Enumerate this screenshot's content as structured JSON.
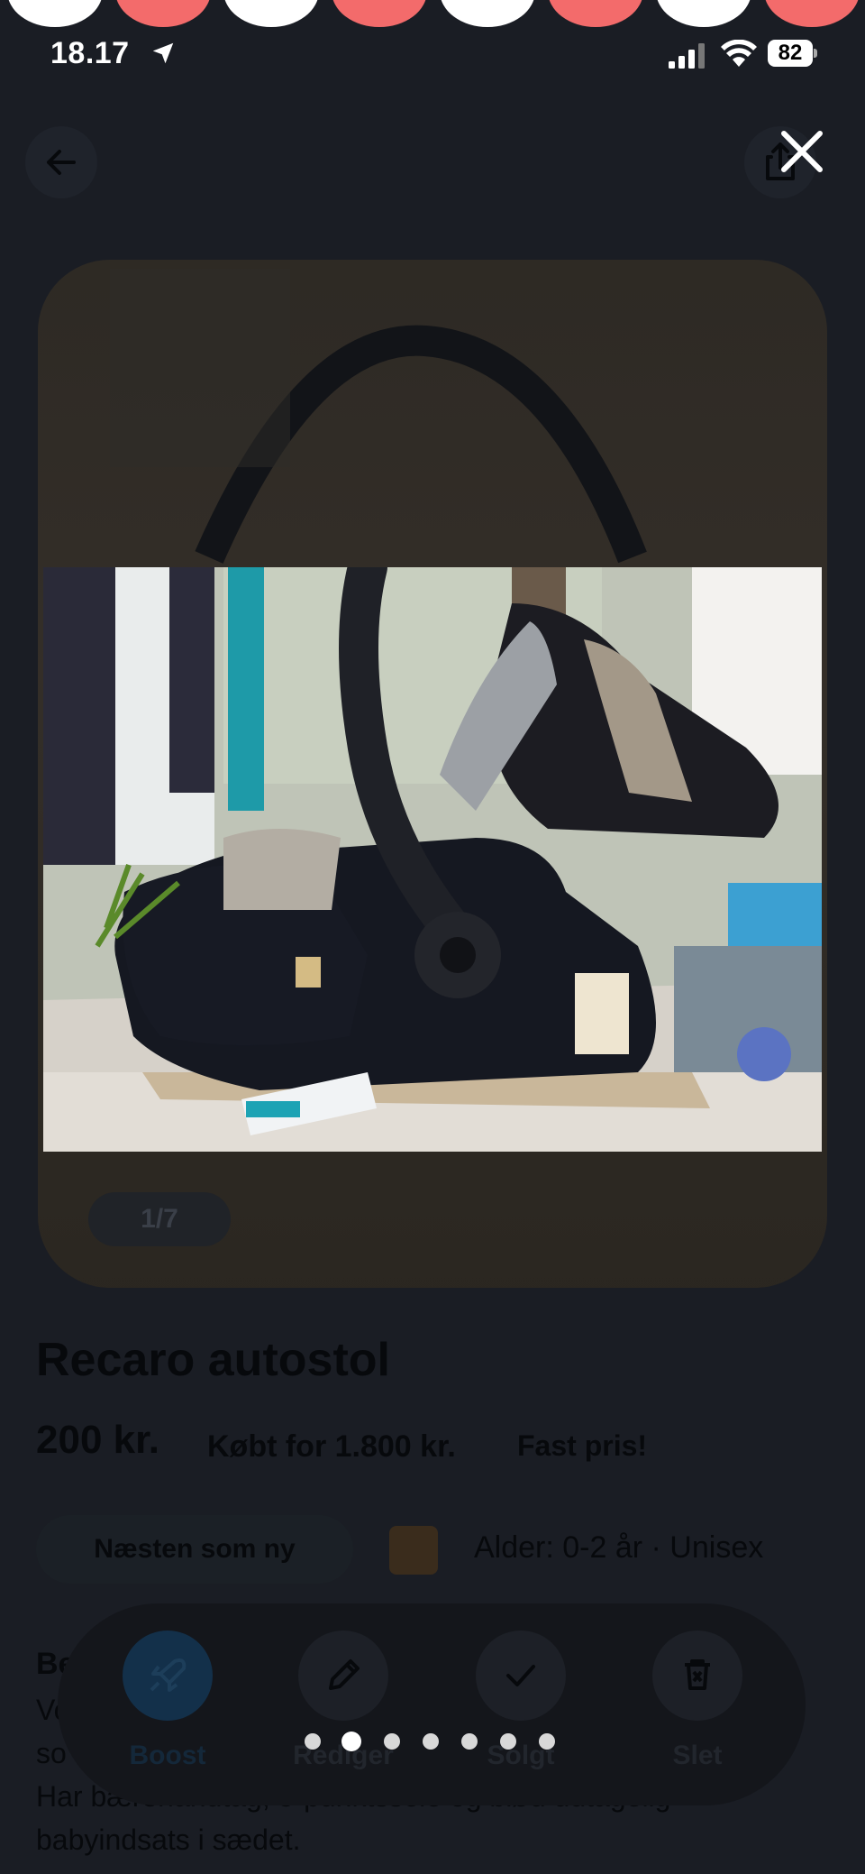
{
  "status_bar": {
    "time": "18.17",
    "battery": "82"
  },
  "listing": {
    "title": "Recaro autostol",
    "price": "200 kr.",
    "original_price": "Købt for 1.800 kr.",
    "price_note": "Fast pris!",
    "condition": "Næsten som ny",
    "age_gender": "Alder: 0-2 år · Unisex",
    "description_heading": "Be",
    "description_visible_1": "Vo",
    "description_visible_2": "so",
    "description_line3": "Har bærehandtag, 5-punktssele og blød udtagelig",
    "description_line4": "babyindsats i sædet.",
    "photo_counter": "1/7"
  },
  "actions": [
    {
      "label": "Boost",
      "icon": "rocket-icon"
    },
    {
      "label": "Rediger",
      "icon": "pencil-icon"
    },
    {
      "label": "Solgt",
      "icon": "check-icon"
    },
    {
      "label": "Slet",
      "icon": "trash-icon"
    }
  ],
  "gallery": {
    "total": 7,
    "current": 2
  },
  "colors": {
    "accent_red": "#f36b6b",
    "boost_blue": "#13304a"
  }
}
